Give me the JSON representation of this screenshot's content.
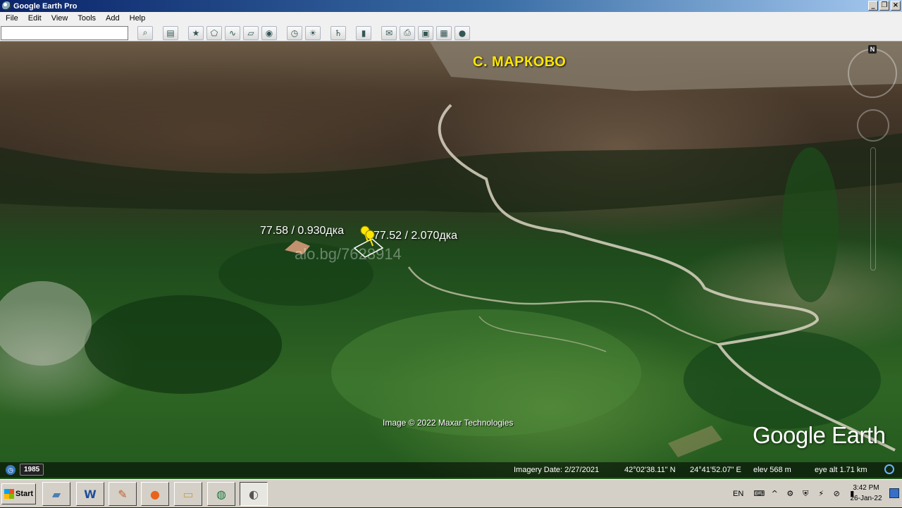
{
  "window": {
    "title": "Google Earth Pro",
    "min_icon": "minimize-icon",
    "restore_icon": "restore-icon",
    "close_icon": "close-icon"
  },
  "menu": [
    "File",
    "Edit",
    "View",
    "Tools",
    "Add",
    "Help"
  ],
  "search": {
    "value": "",
    "placeholder": ""
  },
  "toolbar_icons": [
    "search-icon",
    "sidebar-icon",
    "placemark-icon",
    "polygon-icon",
    "path-icon",
    "image-overlay-icon",
    "record-tour-icon",
    "historical-imagery-icon",
    "sunlight-icon",
    "planets-icon",
    "ruler-icon",
    "email-icon",
    "print-icon",
    "save-image-icon",
    "view-in-maps-icon",
    "earth-icon"
  ],
  "map": {
    "place_label": "С. МАРКОВО",
    "placemark_a": "77.58 / 0.930дка",
    "placemark_b": "77.52 / 2.070дка",
    "watermark": "alo.bg/7628914",
    "attribution": "Image © 2022 Maxar Technologies",
    "logo": "Google Earth",
    "compass_north": "N"
  },
  "status": {
    "year": "1985",
    "imagery_date": "Imagery Date: 2/27/2021",
    "lat": "42°02'38.11\" N",
    "lon": "24°41'52.07\" E",
    "elev": "elev   568 m",
    "eye_alt": "eye alt   1.71 km"
  },
  "taskbar": {
    "start_label": "Start",
    "apps": [
      "notepad-icon",
      "word-icon",
      "paint-icon",
      "firefox-icon",
      "explorer-icon",
      "browser-globe-icon",
      "google-earth-pro-icon"
    ],
    "lang": "EN",
    "time": "3:42 PM",
    "date": "26-Jan-22"
  }
}
